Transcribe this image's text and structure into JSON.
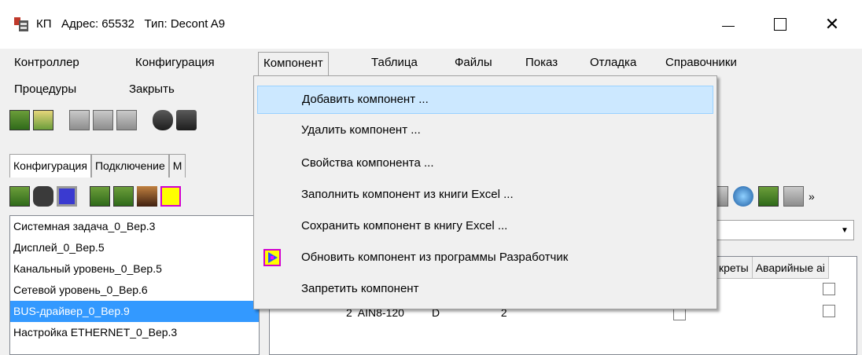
{
  "window": {
    "title": "КП   Адрес: 65532   Тип: Decont A9",
    "icon": "app-station-icon",
    "minimize": "minimize-icon",
    "maximize": "maximize-icon",
    "close_glyph": "✕"
  },
  "menubar": {
    "items": [
      "Контроллер",
      "Конфигурация",
      "Компонент",
      "Таблица",
      "Файлы",
      "Показ",
      "Отладка",
      "Справочники"
    ],
    "items2": [
      "Процедуры",
      "Закрыть"
    ],
    "active": "Компонент"
  },
  "dropdown": {
    "items": [
      "Добавить компонент ...",
      "Удалить компонент ...",
      "Свойства компонента ...",
      "Заполнить компонент из книги Excel ...",
      "Сохранить компонент в книгу Excel ...",
      "Обновить компонент из программы Разработчик",
      "Запретить компонент"
    ],
    "highlighted_index": 0
  },
  "tabs": [
    "Конфигурация",
    "Подключение",
    "М"
  ],
  "left_list": {
    "items": [
      "Системная задача_0_Вер.3",
      "Дисплей_0_Вер.5",
      "Канальный уровень_0_Вер.5",
      "Сетевой уровень_0_Вер.6",
      "BUS-драйвер_0_Вер.9",
      "Настройка ETHERNET_0_Вер.3"
    ],
    "selected_index": 4
  },
  "grid": {
    "headers": [
      "креты",
      "Аварийные аі"
    ],
    "partial_row": "2  AIN8-120         D                    2"
  },
  "colors": {
    "selection": "#3399ff",
    "menu_hover": "#cce8ff",
    "bg": "#f0f0f0"
  }
}
